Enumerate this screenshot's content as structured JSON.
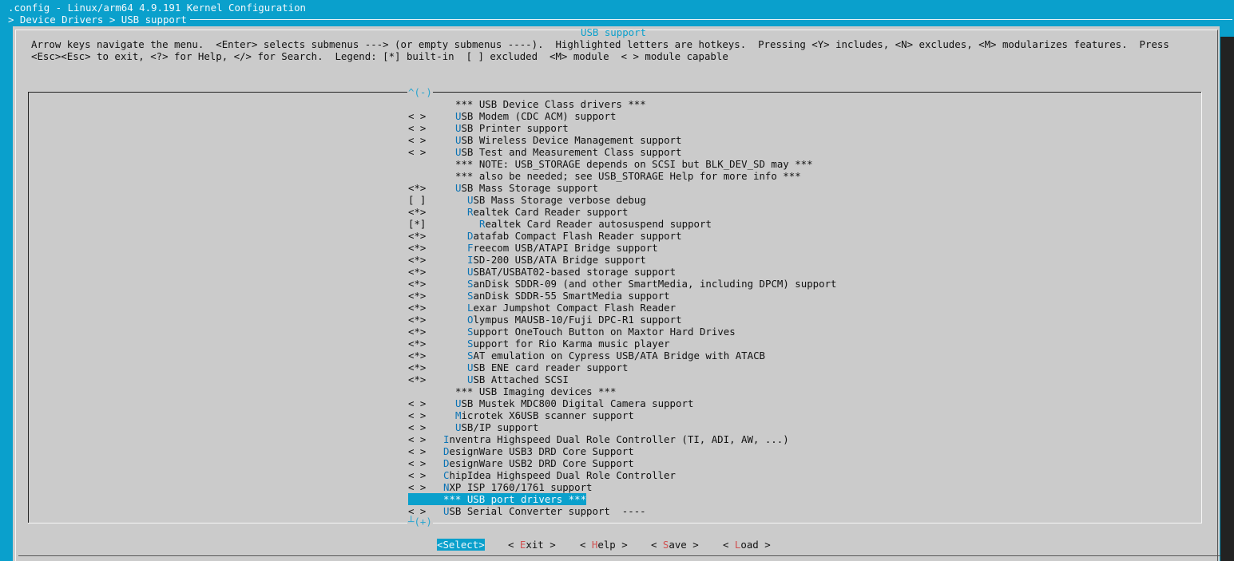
{
  "window": {
    "title": ".config - Linux/arm64 4.9.191 Kernel Configuration",
    "breadcrumb": "> Device Drivers > USB support"
  },
  "dialog": {
    "title": "USB support",
    "help_line1": "Arrow keys navigate the menu.  <Enter> selects submenus ---> (or empty submenus ----).  Highlighted letters are hotkeys.  Pressing <Y> includes, <N> excludes, <M> modularizes features.  Press",
    "help_line2": "<Esc><Esc> to exit, <?> for Help, </> for Search.  Legend: [*] built-in  [ ] excluded  <M> module  < > module capable",
    "scroll_up": "^(-)",
    "scroll_down": "┴(+)"
  },
  "menu": {
    "items": [
      {
        "mark": "",
        "indent": 1,
        "hot": "",
        "rest": "*** USB Device Class drivers ***"
      },
      {
        "mark": "< >",
        "indent": 1,
        "hot": "U",
        "rest": "SB Modem (CDC ACM) support"
      },
      {
        "mark": "< >",
        "indent": 1,
        "hot": "U",
        "rest": "SB Printer support"
      },
      {
        "mark": "< >",
        "indent": 1,
        "hot": "U",
        "rest": "SB Wireless Device Management support"
      },
      {
        "mark": "< >",
        "indent": 1,
        "hot": "U",
        "rest": "SB Test and Measurement Class support"
      },
      {
        "mark": "",
        "indent": 1,
        "hot": "",
        "rest": "*** NOTE: USB_STORAGE depends on SCSI but BLK_DEV_SD may ***"
      },
      {
        "mark": "",
        "indent": 1,
        "hot": "",
        "rest": "*** also be needed; see USB_STORAGE Help for more info ***"
      },
      {
        "mark": "<*>",
        "indent": 1,
        "hot": "U",
        "rest": "SB Mass Storage support"
      },
      {
        "mark": "[ ]",
        "indent": 2,
        "hot": "U",
        "rest": "SB Mass Storage verbose debug"
      },
      {
        "mark": "<*>",
        "indent": 2,
        "hot": "R",
        "rest": "ealtek Card Reader support"
      },
      {
        "mark": "[*]",
        "indent": 3,
        "hot": "R",
        "rest": "ealtek Card Reader autosuspend support"
      },
      {
        "mark": "<*>",
        "indent": 2,
        "hot": "D",
        "rest": "atafab Compact Flash Reader support"
      },
      {
        "mark": "<*>",
        "indent": 2,
        "hot": "F",
        "rest": "reecom USB/ATAPI Bridge support"
      },
      {
        "mark": "<*>",
        "indent": 2,
        "hot": "I",
        "rest": "SD-200 USB/ATA Bridge support"
      },
      {
        "mark": "<*>",
        "indent": 2,
        "hot": "U",
        "rest": "SBAT/USBAT02-based storage support"
      },
      {
        "mark": "<*>",
        "indent": 2,
        "hot": "S",
        "rest": "anDisk SDDR-09 (and other SmartMedia, including DPCM) support"
      },
      {
        "mark": "<*>",
        "indent": 2,
        "hot": "S",
        "rest": "anDisk SDDR-55 SmartMedia support"
      },
      {
        "mark": "<*>",
        "indent": 2,
        "hot": "L",
        "rest": "exar Jumpshot Compact Flash Reader"
      },
      {
        "mark": "<*>",
        "indent": 2,
        "hot": "O",
        "rest": "lympus MAUSB-10/Fuji DPC-R1 support"
      },
      {
        "mark": "<*>",
        "indent": 2,
        "hot": "S",
        "rest": "upport OneTouch Button on Maxtor Hard Drives"
      },
      {
        "mark": "<*>",
        "indent": 2,
        "hot": "S",
        "rest": "upport for Rio Karma music player"
      },
      {
        "mark": "<*>",
        "indent": 2,
        "hot": "S",
        "rest": "AT emulation on Cypress USB/ATA Bridge with ATACB"
      },
      {
        "mark": "<*>",
        "indent": 2,
        "hot": "U",
        "rest": "SB ENE card reader support"
      },
      {
        "mark": "<*>",
        "indent": 2,
        "hot": "U",
        "rest": "SB Attached SCSI"
      },
      {
        "mark": "",
        "indent": 1,
        "hot": "",
        "rest": "*** USB Imaging devices ***"
      },
      {
        "mark": "< >",
        "indent": 1,
        "hot": "U",
        "rest": "SB Mustek MDC800 Digital Camera support"
      },
      {
        "mark": "< >",
        "indent": 1,
        "hot": "M",
        "rest": "icrotek X6USB scanner support"
      },
      {
        "mark": "< >",
        "indent": 1,
        "hot": "U",
        "rest": "SB/IP support"
      },
      {
        "mark": "< >",
        "indent": 0,
        "hot": "I",
        "rest": "nventra Highspeed Dual Role Controller (TI, ADI, AW, ...)"
      },
      {
        "mark": "< >",
        "indent": 0,
        "hot": "D",
        "rest": "esignWare USB3 DRD Core Support"
      },
      {
        "mark": "< >",
        "indent": 0,
        "hot": "D",
        "rest": "esignWare USB2 DRD Core Support"
      },
      {
        "mark": "< >",
        "indent": 0,
        "hot": "C",
        "rest": "hipIdea Highspeed Dual Role Controller"
      },
      {
        "mark": "< >",
        "indent": 0,
        "hot": "N",
        "rest": "XP ISP 1760/1761 support"
      },
      {
        "mark": "",
        "indent": 0,
        "hot": "",
        "rest": "*** USB port drivers ***",
        "selected": true
      },
      {
        "mark": "< >",
        "indent": 0,
        "hot": "U",
        "rest": "SB Serial Converter support  ----"
      }
    ]
  },
  "buttons": {
    "select": "<Select>",
    "exit_pre": "< ",
    "exit_hot": "E",
    "exit_rest": "xit >",
    "help_pre": "< ",
    "help_hot": "H",
    "help_rest": "elp >",
    "save_pre": "< ",
    "save_hot": "S",
    "save_rest": "ave >",
    "load_pre": "< ",
    "load_hot": "L",
    "load_rest": "oad >"
  },
  "colors": {
    "background": "#0aa0cc",
    "dialog": "#cbcbcb",
    "hotkey": "#0b73b4",
    "button_hotkey": "#d05050"
  }
}
